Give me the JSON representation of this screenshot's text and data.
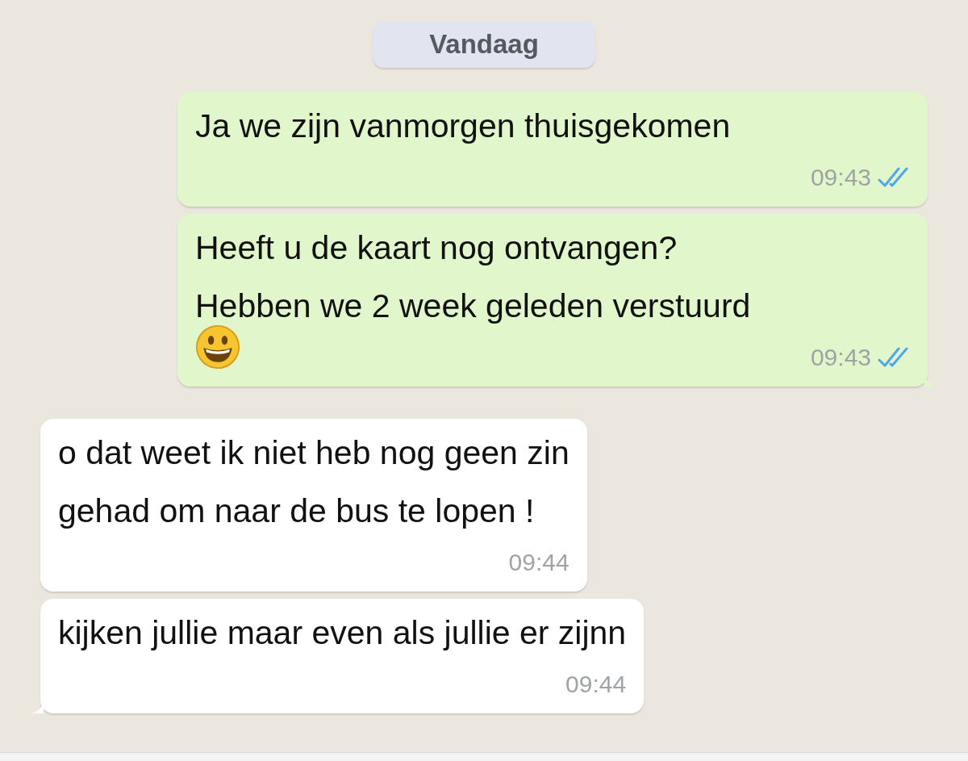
{
  "date_label": "Vandaag",
  "messages": [
    {
      "kind": "outgoing",
      "text": "Ja we zijn vanmorgen thuisgekomen",
      "emoji": false,
      "time": "09:43",
      "read": true,
      "tail": false
    },
    {
      "kind": "outgoing",
      "text": "Heeft u de kaart nog ontvangen?\nHebben we 2 week geleden verstuurd",
      "emoji": true,
      "time": "09:43",
      "read": true,
      "tail": true
    },
    {
      "kind": "incoming",
      "text": "o dat weet ik niet heb nog geen zin\ngehad om naar de bus te lopen !",
      "emoji": false,
      "time": "09:44",
      "tail": false
    },
    {
      "kind": "incoming",
      "text": "kijken jullie maar even als jullie er zijnn",
      "emoji": false,
      "time": "09:44",
      "tail": true
    }
  ]
}
